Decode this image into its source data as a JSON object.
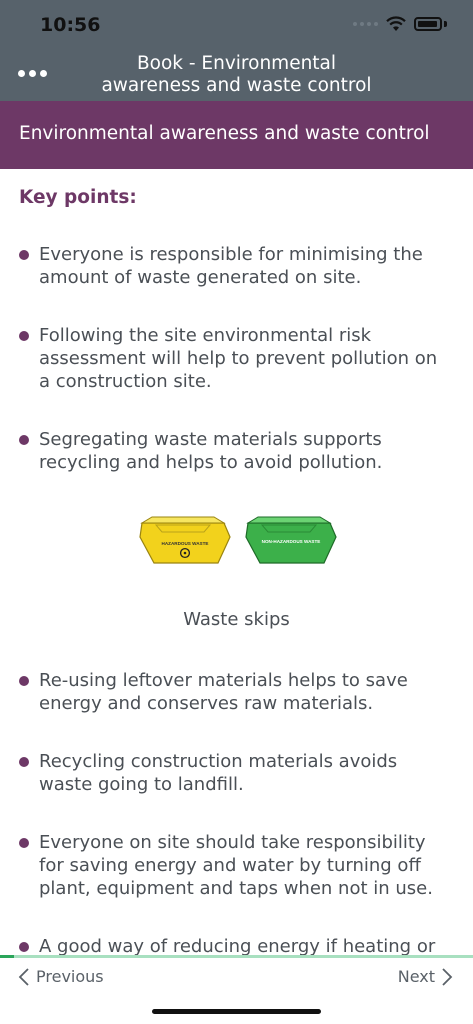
{
  "status": {
    "time": "10:56"
  },
  "header": {
    "title": "Book - Environmental awareness and waste control",
    "menu_icon": "more-dots-icon"
  },
  "chapter": {
    "title": "Environmental awareness and waste control"
  },
  "content": {
    "key_points_title": "Key points:",
    "bullets_top": [
      "Everyone is responsible for minimising the amount of waste generated on site.",
      "Following the site environmental risk assessment will help to prevent pollution on a construction site.",
      "Segregating waste materials supports recycling and helps to avoid pollution."
    ],
    "image": {
      "left_skip_label": "HAZARDOUS WASTE",
      "right_skip_label": "NON-HAZARDOUS WASTE",
      "caption": "Waste skips"
    },
    "bullets_bottom": [
      "Re-using leftover materials helps to save energy and conserves raw materials.",
      "Recycling construction materials avoids waste going to landfill.",
      "Everyone on site should take responsibility for saving energy and water by turning off plant, equipment and taps when not in use.",
      "A good way of reducing energy if heating or"
    ]
  },
  "footer": {
    "previous_label": "Previous",
    "next_label": "Next",
    "progress": 0.03,
    "colors": {
      "fill": "#2aa55a",
      "track": "#a8e0c0"
    }
  }
}
